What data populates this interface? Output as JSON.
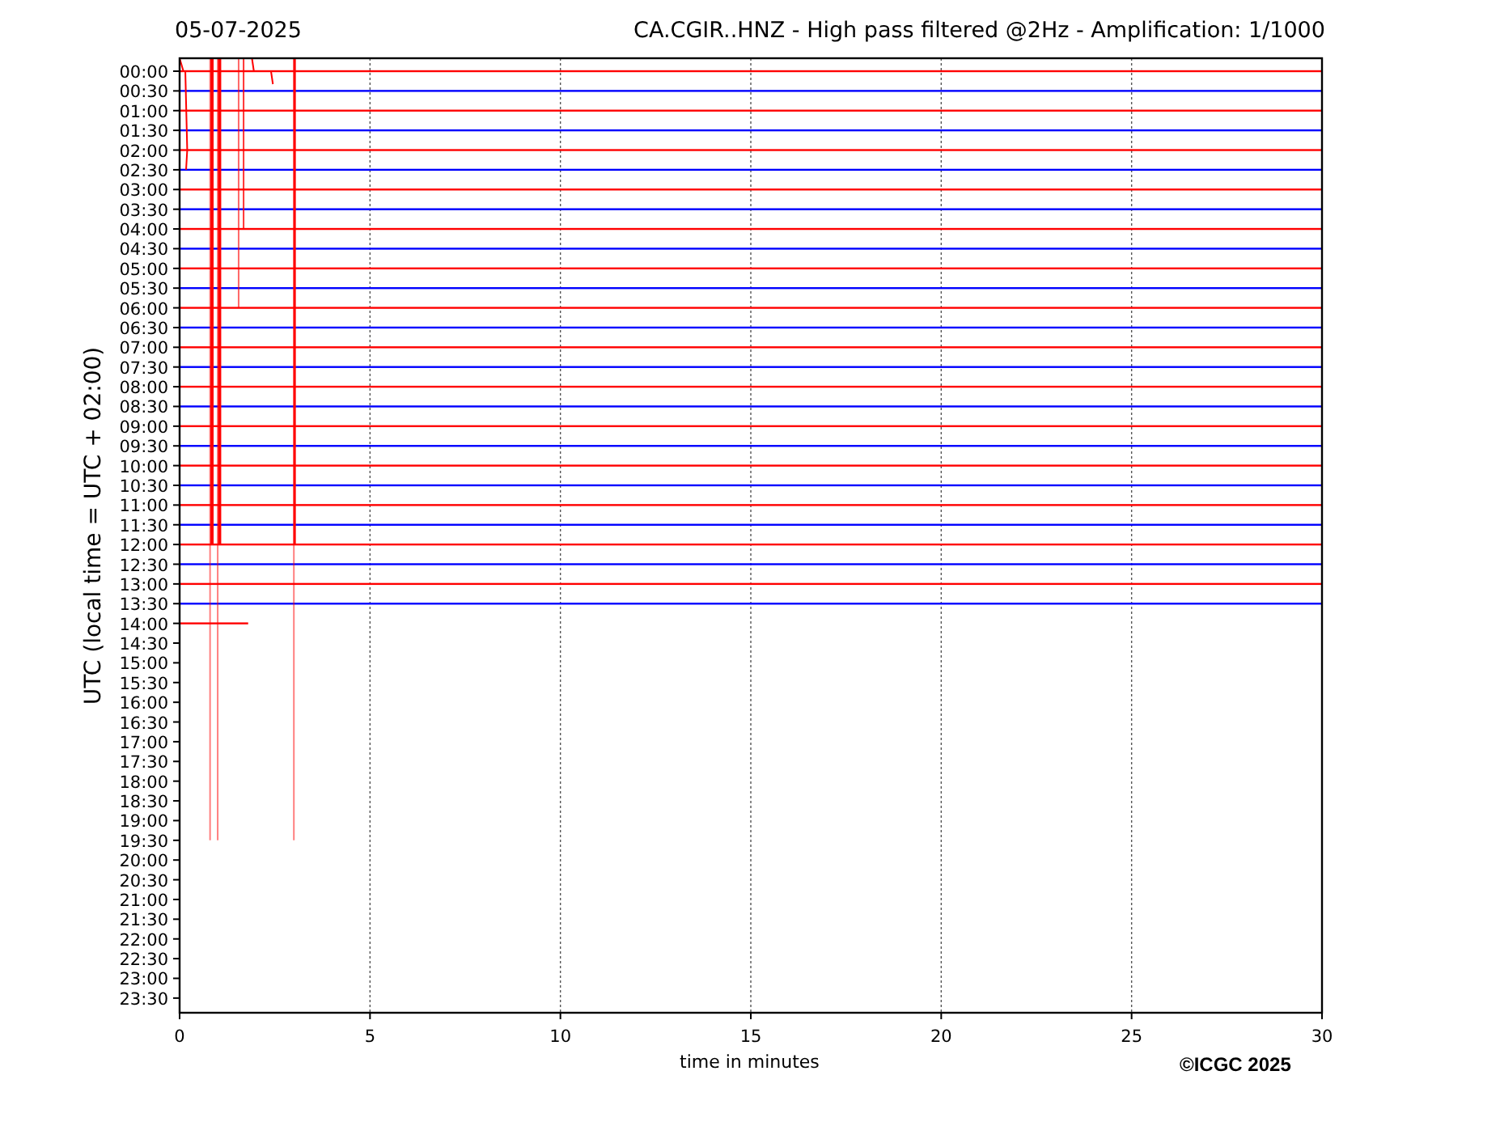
{
  "header": {
    "date": "05-07-2025",
    "title": "CA.CGIR..HNZ - High pass filtered @2Hz - Amplification: 1/1000"
  },
  "y_axis": {
    "label": "UTC (local time = UTC + 02:00)",
    "ticks": [
      "00:00",
      "00:30",
      "01:00",
      "01:30",
      "02:00",
      "02:30",
      "03:00",
      "03:30",
      "04:00",
      "04:30",
      "05:00",
      "05:30",
      "06:00",
      "06:30",
      "07:00",
      "07:30",
      "08:00",
      "08:30",
      "09:00",
      "09:30",
      "10:00",
      "10:30",
      "11:00",
      "11:30",
      "12:00",
      "12:30",
      "13:00",
      "13:30",
      "14:00",
      "14:30",
      "15:00",
      "15:30",
      "16:00",
      "16:30",
      "17:00",
      "17:30",
      "18:00",
      "18:30",
      "19:00",
      "19:30",
      "20:00",
      "20:30",
      "21:00",
      "21:30",
      "22:00",
      "22:30",
      "23:00",
      "23:30"
    ]
  },
  "x_axis": {
    "label": "time in minutes",
    "ticks": [
      "0",
      "5",
      "10",
      "15",
      "20",
      "25",
      "30"
    ]
  },
  "traces": [
    {
      "color": "#ff0000",
      "partial": false
    },
    {
      "color": "#0000ff",
      "partial": false
    },
    {
      "color": "#ff0000",
      "partial": false
    },
    {
      "color": "#0000ff",
      "partial": false
    },
    {
      "color": "#ff0000",
      "partial": false
    },
    {
      "color": "#0000ff",
      "partial": false
    },
    {
      "color": "#ff0000",
      "partial": false
    },
    {
      "color": "#0000ff",
      "partial": false
    },
    {
      "color": "#ff0000",
      "partial": false
    },
    {
      "color": "#0000ff",
      "partial": false
    },
    {
      "color": "#ff0000",
      "partial": false
    },
    {
      "color": "#0000ff",
      "partial": false
    },
    {
      "color": "#ff0000",
      "partial": false
    },
    {
      "color": "#0000ff",
      "partial": false
    },
    {
      "color": "#ff0000",
      "partial": false
    },
    {
      "color": "#0000ff",
      "partial": false
    },
    {
      "color": "#ff0000",
      "partial": false
    },
    {
      "color": "#0000ff",
      "partial": false
    },
    {
      "color": "#ff0000",
      "partial": false
    },
    {
      "color": "#0000ff",
      "partial": false
    },
    {
      "color": "#ff0000",
      "partial": false
    },
    {
      "color": "#0000ff",
      "partial": false
    },
    {
      "color": "#ff0000",
      "partial": false
    },
    {
      "color": "#0000ff",
      "partial": false
    },
    {
      "color": "#ff0000",
      "partial": false
    },
    {
      "color": "#0000ff",
      "partial": false
    },
    {
      "color": "#ff0000",
      "partial": false
    },
    {
      "color": "#0000ff",
      "partial": false
    },
    {
      "color": "#ff0000",
      "partial": true
    }
  ],
  "copyright": "©ICGC 2025"
}
